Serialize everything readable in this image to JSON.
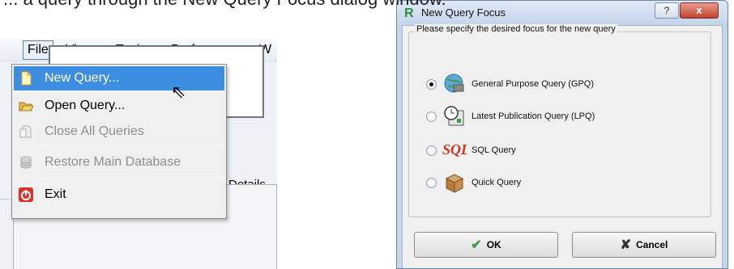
{
  "caption": {
    "text": "... a query through the New Query Focus dialog window."
  },
  "app": {
    "menubar": [
      {
        "label": "File",
        "active": true
      },
      {
        "label": "View"
      },
      {
        "label": "Tools"
      },
      {
        "label": "Preferences"
      },
      {
        "label": "W"
      }
    ],
    "file_menu": [
      {
        "label": "New Query...",
        "icon": "new-document-icon",
        "state": "highlighted"
      },
      {
        "label": "Open Query...",
        "icon": "open-folder-icon",
        "state": "enabled"
      },
      {
        "label": "Close All Queries",
        "icon": "close-document-icon",
        "state": "disabled"
      },
      {
        "label": "Restore Main Database",
        "icon": "database-icon",
        "state": "disabled"
      },
      {
        "label": "Exit",
        "icon": "power-icon",
        "state": "enabled"
      }
    ],
    "details_label": "Details"
  },
  "dialog": {
    "title": "New Query Focus",
    "title_icon": "r-logo-icon",
    "help_button": "?",
    "close_button": "x",
    "group_label": "Please specify the desired focus for the new query",
    "options": [
      {
        "label": "General Purpose Query (GPQ)",
        "icon": "globe-icon",
        "checked": true
      },
      {
        "label": "Latest Publication Query (LPQ)",
        "icon": "clock-document-icon",
        "checked": false
      },
      {
        "label": "SQL Query",
        "icon": "sql-icon",
        "checked": false
      },
      {
        "label": "Quick Query",
        "icon": "box-icon",
        "checked": false
      }
    ],
    "ok_label": "OK",
    "cancel_label": "Cancel"
  },
  "colors": {
    "highlight": "#3d8ee0",
    "dialog_frame": "#c6d6ea",
    "close_button": "#c1432e"
  }
}
